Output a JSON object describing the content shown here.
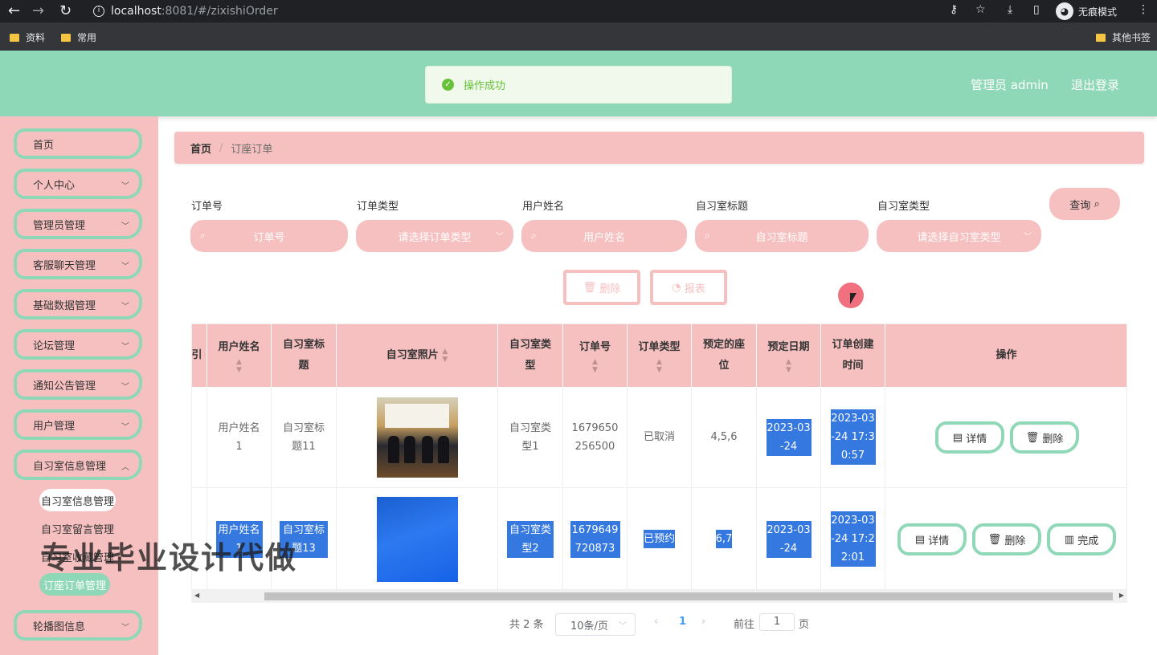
{
  "browser": {
    "url_host": "localhost",
    "url_rest": ":8081/#/zixishiOrder",
    "incognito_label": "无痕模式",
    "bookmarks": [
      "资料",
      "常用"
    ],
    "other_bookmarks": "其他书签"
  },
  "header": {
    "user_label": "管理员 admin",
    "logout_label": "退出登录"
  },
  "toast": {
    "text": "操作成功"
  },
  "sidebar": {
    "items": [
      {
        "label": "首页"
      },
      {
        "label": "个人中心"
      },
      {
        "label": "管理员管理"
      },
      {
        "label": "客服聊天管理"
      },
      {
        "label": "基础数据管理"
      },
      {
        "label": "论坛管理"
      },
      {
        "label": "通知公告管理"
      },
      {
        "label": "用户管理"
      },
      {
        "label": "自习室信息管理"
      },
      {
        "label": "轮播图信息"
      }
    ],
    "submenu": [
      {
        "label": "自习室信息管理"
      },
      {
        "label": "自习室留言管理"
      },
      {
        "label": "自习室收藏管理"
      },
      {
        "label": "订座订单管理"
      }
    ]
  },
  "watermark": "专业毕业设计代做",
  "breadcrumb": {
    "home": "首页",
    "separator": "/",
    "current": "订座订单"
  },
  "search": {
    "fields": [
      {
        "label": "订单号",
        "placeholder": "订单号"
      },
      {
        "label": "订单类型",
        "placeholder": "请选择订单类型"
      },
      {
        "label": "用户姓名",
        "placeholder": "用户姓名"
      },
      {
        "label": "自习室标题",
        "placeholder": "自习室标题"
      },
      {
        "label": "自习室类型",
        "placeholder": "请选择自习室类型"
      }
    ],
    "query_label": "查询"
  },
  "actions": {
    "delete_label": "删除",
    "report_label": "报表"
  },
  "table": {
    "columns": [
      {
        "label": "引"
      },
      {
        "label": "用户姓名"
      },
      {
        "label": "自习室标题"
      },
      {
        "label": "自习室照片"
      },
      {
        "label": "自习室类型"
      },
      {
        "label": "订单号"
      },
      {
        "label": "订单类型"
      },
      {
        "label": "预定的座位"
      },
      {
        "label": "预定日期"
      },
      {
        "label": "订单创建时间"
      },
      {
        "label": "操作"
      }
    ],
    "rows": [
      {
        "user_name": "用户姓名1",
        "room_title": "自习室标题11",
        "room_type": "自习室类型1",
        "order_no": "1679650256500",
        "order_type": "已取消",
        "seats": "4,5,6",
        "date": "2023-03-24",
        "created": "2023-03-24 17:30:57",
        "ops": [
          "详情",
          "删除"
        ]
      },
      {
        "user_name": "用户姓名1",
        "room_title": "自习室标题13",
        "room_type": "自习室类型2",
        "order_no": "1679649720873",
        "order_type": "已预约",
        "seats": "6,7",
        "date": "2023-03-24",
        "created": "2023-03-24 17:22:01",
        "ops": [
          "详情",
          "删除",
          "完成"
        ]
      }
    ]
  },
  "pagination": {
    "total": "共 2 条",
    "page_size": "10条/页",
    "current_page": "1",
    "goto_label": "前往",
    "goto_value": "1",
    "page_suffix": "页"
  },
  "colors": {
    "accent_green": "#8fd8b7",
    "accent_pink": "#f7c0c0",
    "highlight": "#3478e0"
  }
}
